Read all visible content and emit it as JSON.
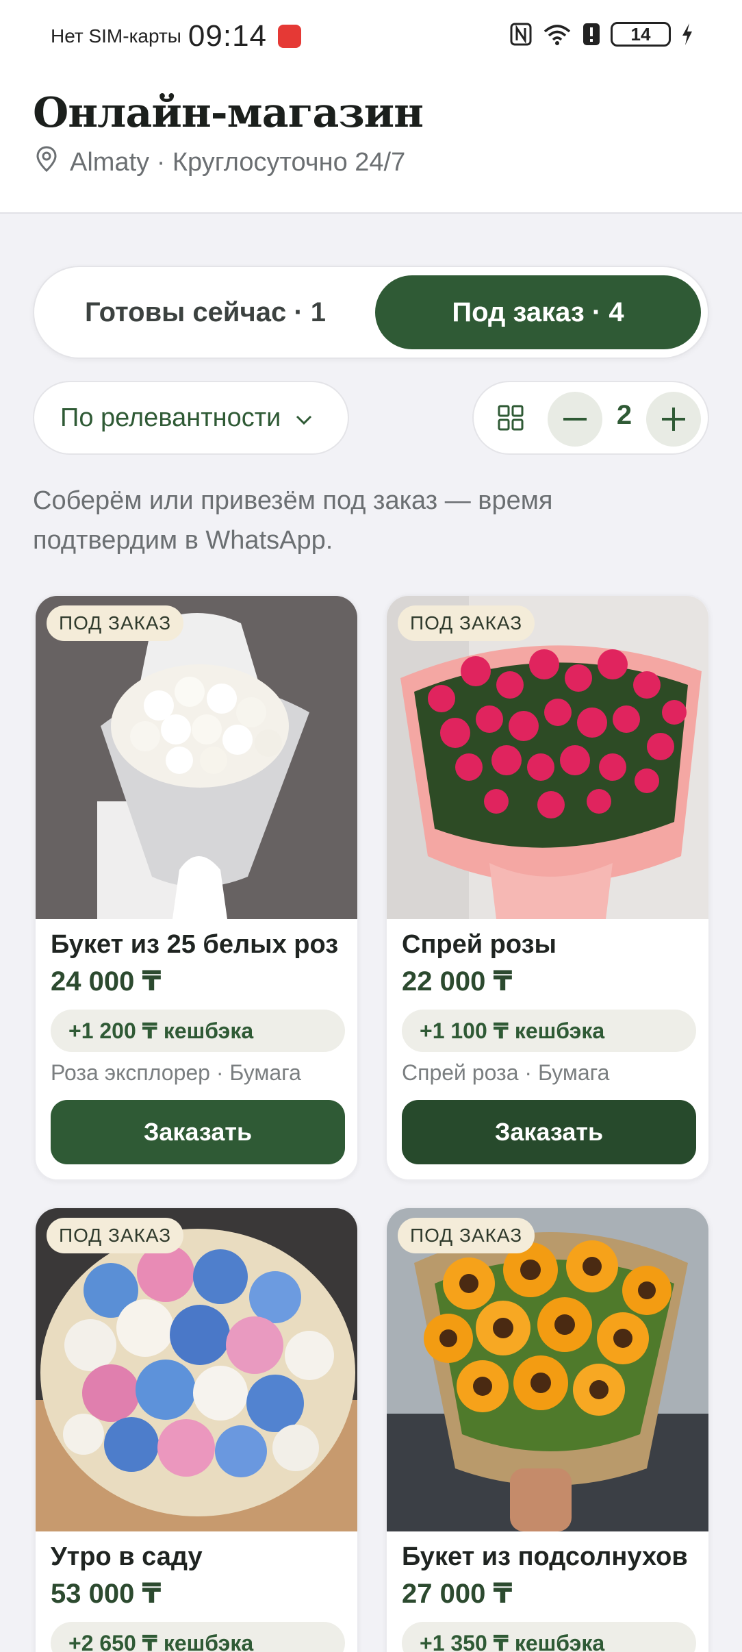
{
  "status_bar": {
    "sim": "Нет SIM-карты",
    "time": "09:14",
    "battery": "14"
  },
  "header": {
    "title": "Онлайн-магазин",
    "location": "Almaty · Круглосуточно 24/7"
  },
  "tabs": [
    {
      "label": "Готовы сейчас · 1",
      "active": false
    },
    {
      "label": "Под заказ · 4",
      "active": true
    }
  ],
  "sort": {
    "label": "По релевантности"
  },
  "columns": {
    "value": "2"
  },
  "hint": "Соберём или привезём под заказ — время подтвердим в WhatsApp.",
  "products": [
    {
      "badge": "ПОД ЗАКАЗ",
      "name": "Букет из 25 белых роз",
      "price": "24 000 ₸",
      "cashback": "+1 200 ₸ кешбэка",
      "meta": "Роза эксплорер · Бумага",
      "button": "Заказать"
    },
    {
      "badge": "ПОД ЗАКАЗ",
      "name": "Спрей розы",
      "price": "22 000 ₸",
      "cashback": "+1 100 ₸ кешбэка",
      "meta": "Спрей роза · Бумага",
      "button": "Заказать"
    },
    {
      "badge": "ПОД ЗАКАЗ",
      "name": "Утро в саду",
      "price": "53 000 ₸",
      "cashback": "+2 650 ₸ кешбэка"
    },
    {
      "badge": "ПОД ЗАКАЗ",
      "name": "Букет из подсолнухов",
      "price": "27 000 ₸",
      "cashback": "+1 350 ₸ кешбэка"
    }
  ],
  "colors": {
    "accent": "#2f5a35",
    "badge_bg": "#f4ecd9",
    "background": "#f2f2f6"
  }
}
